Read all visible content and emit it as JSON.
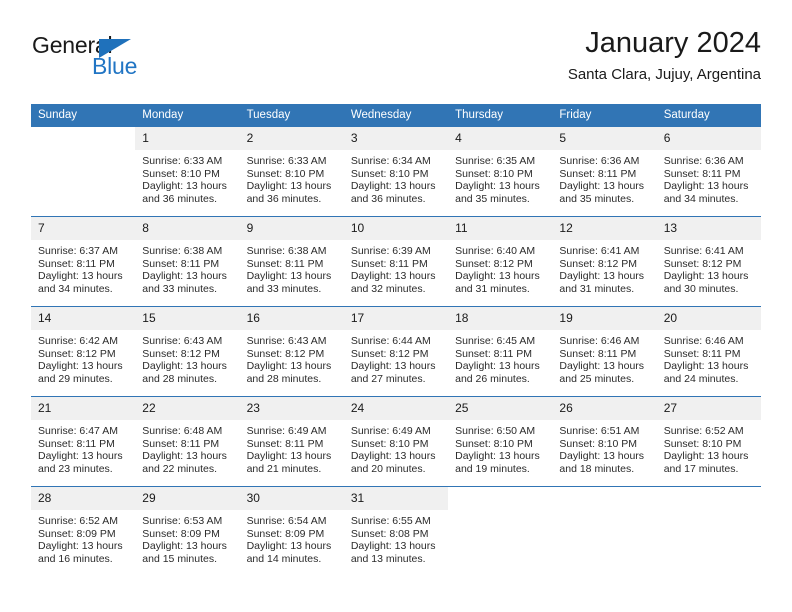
{
  "brand": {
    "name_part1": "General",
    "name_part2": "Blue",
    "flag_icon": "triangle-flag-icon",
    "accent_color": "#1f71bb"
  },
  "header": {
    "title": "January 2024",
    "location": "Santa Clara, Jujuy, Argentina"
  },
  "calendar": {
    "header_bg_color": "#3175b5",
    "daynum_bg_color": "#f0f0f0",
    "weekday_headers": [
      "Sunday",
      "Monday",
      "Tuesday",
      "Wednesday",
      "Thursday",
      "Friday",
      "Saturday"
    ],
    "weeks": [
      [
        {
          "day": "",
          "sunrise": "",
          "sunset": "",
          "daylight_line1": "",
          "daylight_line2": "",
          "empty": true
        },
        {
          "day": "1",
          "sunrise": "Sunrise: 6:33 AM",
          "sunset": "Sunset: 8:10 PM",
          "daylight_line1": "Daylight: 13 hours",
          "daylight_line2": "and 36 minutes."
        },
        {
          "day": "2",
          "sunrise": "Sunrise: 6:33 AM",
          "sunset": "Sunset: 8:10 PM",
          "daylight_line1": "Daylight: 13 hours",
          "daylight_line2": "and 36 minutes."
        },
        {
          "day": "3",
          "sunrise": "Sunrise: 6:34 AM",
          "sunset": "Sunset: 8:10 PM",
          "daylight_line1": "Daylight: 13 hours",
          "daylight_line2": "and 36 minutes."
        },
        {
          "day": "4",
          "sunrise": "Sunrise: 6:35 AM",
          "sunset": "Sunset: 8:10 PM",
          "daylight_line1": "Daylight: 13 hours",
          "daylight_line2": "and 35 minutes."
        },
        {
          "day": "5",
          "sunrise": "Sunrise: 6:36 AM",
          "sunset": "Sunset: 8:11 PM",
          "daylight_line1": "Daylight: 13 hours",
          "daylight_line2": "and 35 minutes."
        },
        {
          "day": "6",
          "sunrise": "Sunrise: 6:36 AM",
          "sunset": "Sunset: 8:11 PM",
          "daylight_line1": "Daylight: 13 hours",
          "daylight_line2": "and 34 minutes."
        }
      ],
      [
        {
          "day": "7",
          "sunrise": "Sunrise: 6:37 AM",
          "sunset": "Sunset: 8:11 PM",
          "daylight_line1": "Daylight: 13 hours",
          "daylight_line2": "and 34 minutes."
        },
        {
          "day": "8",
          "sunrise": "Sunrise: 6:38 AM",
          "sunset": "Sunset: 8:11 PM",
          "daylight_line1": "Daylight: 13 hours",
          "daylight_line2": "and 33 minutes."
        },
        {
          "day": "9",
          "sunrise": "Sunrise: 6:38 AM",
          "sunset": "Sunset: 8:11 PM",
          "daylight_line1": "Daylight: 13 hours",
          "daylight_line2": "and 33 minutes."
        },
        {
          "day": "10",
          "sunrise": "Sunrise: 6:39 AM",
          "sunset": "Sunset: 8:11 PM",
          "daylight_line1": "Daylight: 13 hours",
          "daylight_line2": "and 32 minutes."
        },
        {
          "day": "11",
          "sunrise": "Sunrise: 6:40 AM",
          "sunset": "Sunset: 8:12 PM",
          "daylight_line1": "Daylight: 13 hours",
          "daylight_line2": "and 31 minutes."
        },
        {
          "day": "12",
          "sunrise": "Sunrise: 6:41 AM",
          "sunset": "Sunset: 8:12 PM",
          "daylight_line1": "Daylight: 13 hours",
          "daylight_line2": "and 31 minutes."
        },
        {
          "day": "13",
          "sunrise": "Sunrise: 6:41 AM",
          "sunset": "Sunset: 8:12 PM",
          "daylight_line1": "Daylight: 13 hours",
          "daylight_line2": "and 30 minutes."
        }
      ],
      [
        {
          "day": "14",
          "sunrise": "Sunrise: 6:42 AM",
          "sunset": "Sunset: 8:12 PM",
          "daylight_line1": "Daylight: 13 hours",
          "daylight_line2": "and 29 minutes."
        },
        {
          "day": "15",
          "sunrise": "Sunrise: 6:43 AM",
          "sunset": "Sunset: 8:12 PM",
          "daylight_line1": "Daylight: 13 hours",
          "daylight_line2": "and 28 minutes."
        },
        {
          "day": "16",
          "sunrise": "Sunrise: 6:43 AM",
          "sunset": "Sunset: 8:12 PM",
          "daylight_line1": "Daylight: 13 hours",
          "daylight_line2": "and 28 minutes."
        },
        {
          "day": "17",
          "sunrise": "Sunrise: 6:44 AM",
          "sunset": "Sunset: 8:12 PM",
          "daylight_line1": "Daylight: 13 hours",
          "daylight_line2": "and 27 minutes."
        },
        {
          "day": "18",
          "sunrise": "Sunrise: 6:45 AM",
          "sunset": "Sunset: 8:11 PM",
          "daylight_line1": "Daylight: 13 hours",
          "daylight_line2": "and 26 minutes."
        },
        {
          "day": "19",
          "sunrise": "Sunrise: 6:46 AM",
          "sunset": "Sunset: 8:11 PM",
          "daylight_line1": "Daylight: 13 hours",
          "daylight_line2": "and 25 minutes."
        },
        {
          "day": "20",
          "sunrise": "Sunrise: 6:46 AM",
          "sunset": "Sunset: 8:11 PM",
          "daylight_line1": "Daylight: 13 hours",
          "daylight_line2": "and 24 minutes."
        }
      ],
      [
        {
          "day": "21",
          "sunrise": "Sunrise: 6:47 AM",
          "sunset": "Sunset: 8:11 PM",
          "daylight_line1": "Daylight: 13 hours",
          "daylight_line2": "and 23 minutes."
        },
        {
          "day": "22",
          "sunrise": "Sunrise: 6:48 AM",
          "sunset": "Sunset: 8:11 PM",
          "daylight_line1": "Daylight: 13 hours",
          "daylight_line2": "and 22 minutes."
        },
        {
          "day": "23",
          "sunrise": "Sunrise: 6:49 AM",
          "sunset": "Sunset: 8:11 PM",
          "daylight_line1": "Daylight: 13 hours",
          "daylight_line2": "and 21 minutes."
        },
        {
          "day": "24",
          "sunrise": "Sunrise: 6:49 AM",
          "sunset": "Sunset: 8:10 PM",
          "daylight_line1": "Daylight: 13 hours",
          "daylight_line2": "and 20 minutes."
        },
        {
          "day": "25",
          "sunrise": "Sunrise: 6:50 AM",
          "sunset": "Sunset: 8:10 PM",
          "daylight_line1": "Daylight: 13 hours",
          "daylight_line2": "and 19 minutes."
        },
        {
          "day": "26",
          "sunrise": "Sunrise: 6:51 AM",
          "sunset": "Sunset: 8:10 PM",
          "daylight_line1": "Daylight: 13 hours",
          "daylight_line2": "and 18 minutes."
        },
        {
          "day": "27",
          "sunrise": "Sunrise: 6:52 AM",
          "sunset": "Sunset: 8:10 PM",
          "daylight_line1": "Daylight: 13 hours",
          "daylight_line2": "and 17 minutes."
        }
      ],
      [
        {
          "day": "28",
          "sunrise": "Sunrise: 6:52 AM",
          "sunset": "Sunset: 8:09 PM",
          "daylight_line1": "Daylight: 13 hours",
          "daylight_line2": "and 16 minutes."
        },
        {
          "day": "29",
          "sunrise": "Sunrise: 6:53 AM",
          "sunset": "Sunset: 8:09 PM",
          "daylight_line1": "Daylight: 13 hours",
          "daylight_line2": "and 15 minutes."
        },
        {
          "day": "30",
          "sunrise": "Sunrise: 6:54 AM",
          "sunset": "Sunset: 8:09 PM",
          "daylight_line1": "Daylight: 13 hours",
          "daylight_line2": "and 14 minutes."
        },
        {
          "day": "31",
          "sunrise": "Sunrise: 6:55 AM",
          "sunset": "Sunset: 8:08 PM",
          "daylight_line1": "Daylight: 13 hours",
          "daylight_line2": "and 13 minutes."
        },
        {
          "day": "",
          "sunrise": "",
          "sunset": "",
          "daylight_line1": "",
          "daylight_line2": "",
          "empty": true
        },
        {
          "day": "",
          "sunrise": "",
          "sunset": "",
          "daylight_line1": "",
          "daylight_line2": "",
          "empty": true
        },
        {
          "day": "",
          "sunrise": "",
          "sunset": "",
          "daylight_line1": "",
          "daylight_line2": "",
          "empty": true
        }
      ]
    ]
  }
}
